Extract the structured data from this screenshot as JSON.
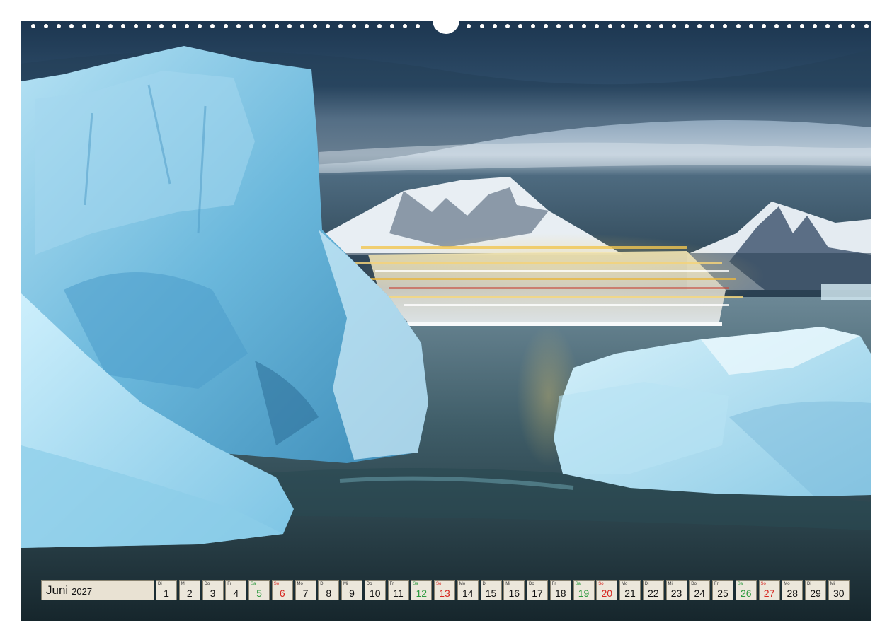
{
  "calendar": {
    "month": "Juni",
    "year": "2027",
    "colors": {
      "saturday": "#2e9a40",
      "sunday": "#d6261f",
      "cell_bg": "#ece7db",
      "cell_border": "#8a8472"
    },
    "days": [
      {
        "wd": "Di",
        "d": "1"
      },
      {
        "wd": "Mi",
        "d": "2"
      },
      {
        "wd": "Do",
        "d": "3"
      },
      {
        "wd": "Fr",
        "d": "4"
      },
      {
        "wd": "Sa",
        "d": "5"
      },
      {
        "wd": "So",
        "d": "6"
      },
      {
        "wd": "Mo",
        "d": "7"
      },
      {
        "wd": "Di",
        "d": "8"
      },
      {
        "wd": "Mi",
        "d": "9"
      },
      {
        "wd": "Do",
        "d": "10"
      },
      {
        "wd": "Fr",
        "d": "11"
      },
      {
        "wd": "Sa",
        "d": "12"
      },
      {
        "wd": "So",
        "d": "13"
      },
      {
        "wd": "Mo",
        "d": "14"
      },
      {
        "wd": "Di",
        "d": "15"
      },
      {
        "wd": "Mi",
        "d": "16"
      },
      {
        "wd": "Do",
        "d": "17"
      },
      {
        "wd": "Fr",
        "d": "18"
      },
      {
        "wd": "Sa",
        "d": "19"
      },
      {
        "wd": "So",
        "d": "20"
      },
      {
        "wd": "Mo",
        "d": "21"
      },
      {
        "wd": "Di",
        "d": "22"
      },
      {
        "wd": "Mi",
        "d": "23"
      },
      {
        "wd": "Do",
        "d": "24"
      },
      {
        "wd": "Fr",
        "d": "25"
      },
      {
        "wd": "Sa",
        "d": "26"
      },
      {
        "wd": "So",
        "d": "27"
      },
      {
        "wd": "Mo",
        "d": "28"
      },
      {
        "wd": "Di",
        "d": "29"
      },
      {
        "wd": "Mi",
        "d": "30"
      }
    ]
  }
}
